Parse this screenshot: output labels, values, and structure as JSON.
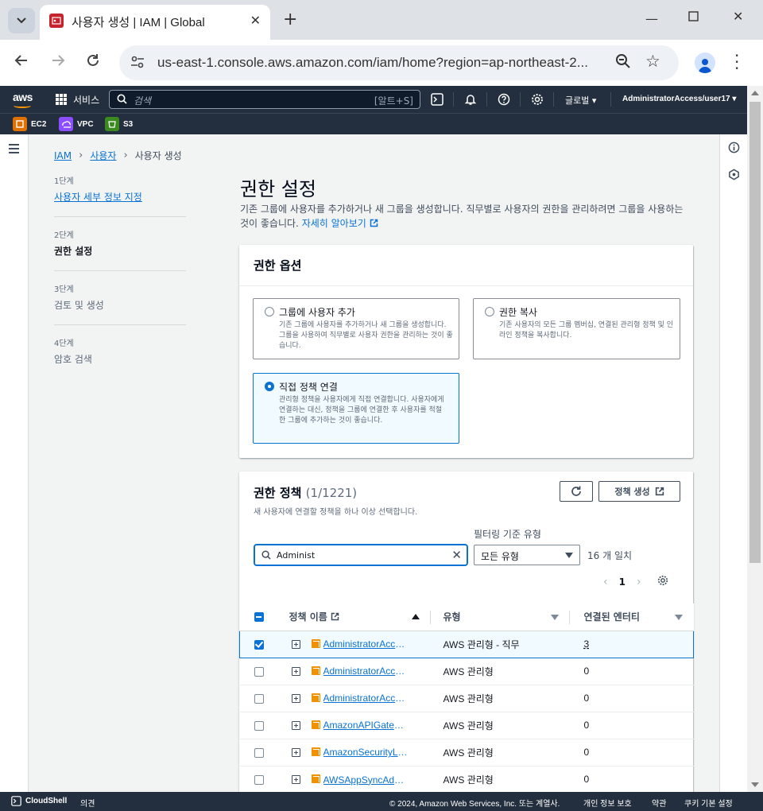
{
  "browser": {
    "tab_title": "사용자 생성 | IAM | Global",
    "url": "us-east-1.console.aws.amazon.com/iam/home?region=ap-northeast-2..."
  },
  "aws_header": {
    "services_label": "서비스",
    "search_placeholder": "검색",
    "search_shortcut": "[알트+S]",
    "region_label": "글로벌",
    "account_label": "AdministratorAccess/user17",
    "favorites": [
      "EC2",
      "VPC",
      "S3"
    ]
  },
  "breadcrumb": {
    "items": [
      "IAM",
      "사용자",
      "사용자 생성"
    ]
  },
  "steps": [
    {
      "num": "1단계",
      "label": "사용자 세부 정보 지정"
    },
    {
      "num": "2단계",
      "label": "권한 설정"
    },
    {
      "num": "3단계",
      "label": "검토 및 생성"
    },
    {
      "num": "4단계",
      "label": "암호 검색"
    }
  ],
  "main": {
    "title": "권한 설정",
    "description": "기존 그룹에 사용자를 추가하거나 새 그룹을 생성합니다. 직무별로 사용자의 권한을 관리하려면 그룹을 사용하는 것이 좋습니다.",
    "learn_more": "자세히 알아보기"
  },
  "permission_options": {
    "title": "권한 옵션",
    "options": [
      {
        "title": "그룹에 사용자 추가",
        "desc": "기존 그룹에 사용자를 추가하거나 새 그룹을 생성합니다. 그룹을 사용하여 직무별로 사용자 권한을 관리하는 것이 좋습니다.",
        "selected": false
      },
      {
        "title": "권한 복사",
        "desc": "기존 사용자의 모든 그룹 멤버십, 연결된 관리형 정책 및 인라인 정책을 복사합니다.",
        "selected": false
      },
      {
        "title": "직접 정책 연결",
        "desc": "관리형 정책을 사용자에게 직접 연결합니다. 사용자에게 연결하는 대신, 정책을 그룹에 연결한 후 사용자를 적절한 그룹에 추가하는 것이 좋습니다.",
        "selected": true
      }
    ]
  },
  "policies": {
    "title": "권한 정책",
    "count": "(1/1221)",
    "subtitle": "새 사용자에 연결할 정책을 하나 이상 선택합니다.",
    "refresh_icon": "refresh-icon",
    "create_button": "정책 생성",
    "search_value": "Administ",
    "filter_label": "필터링 기준 유형",
    "filter_value": "모든 유형",
    "match_count": "16 개 일치",
    "page": "1",
    "columns": [
      "정책 이름",
      "유형",
      "연결된 엔터티"
    ],
    "rows": [
      {
        "name": "AdministratorAccess",
        "type": "AWS 관리형 - 직무",
        "entities": "3",
        "checked": true
      },
      {
        "name": "AdministratorAccess-Amplify",
        "type": "AWS 관리형",
        "entities": "0",
        "checked": false
      },
      {
        "name": "AdministratorAccess-AWSElasticBeanstalk",
        "type": "AWS 관리형",
        "entities": "0",
        "checked": false
      },
      {
        "name": "AmazonAPIGatewayAdministrator",
        "type": "AWS 관리형",
        "entities": "0",
        "checked": false
      },
      {
        "name": "AmazonSecurityLakeAdministrator",
        "type": "AWS 관리형",
        "entities": "0",
        "checked": false
      },
      {
        "name": "AWSAppSyncAdministrator",
        "type": "AWS 관리형",
        "entities": "0",
        "checked": false
      }
    ]
  },
  "footer": {
    "cloudshell": "CloudShell",
    "feedback": "의견",
    "copyright": "© 2024, Amazon Web Services, Inc. 또는 계열사.",
    "privacy": "개인 정보 보호",
    "terms": "약관",
    "cookies": "쿠키 기본 설정"
  },
  "colors": {
    "aws_dark": "#232f3e",
    "link_blue": "#0972d3",
    "aws_orange": "#ff9900"
  }
}
